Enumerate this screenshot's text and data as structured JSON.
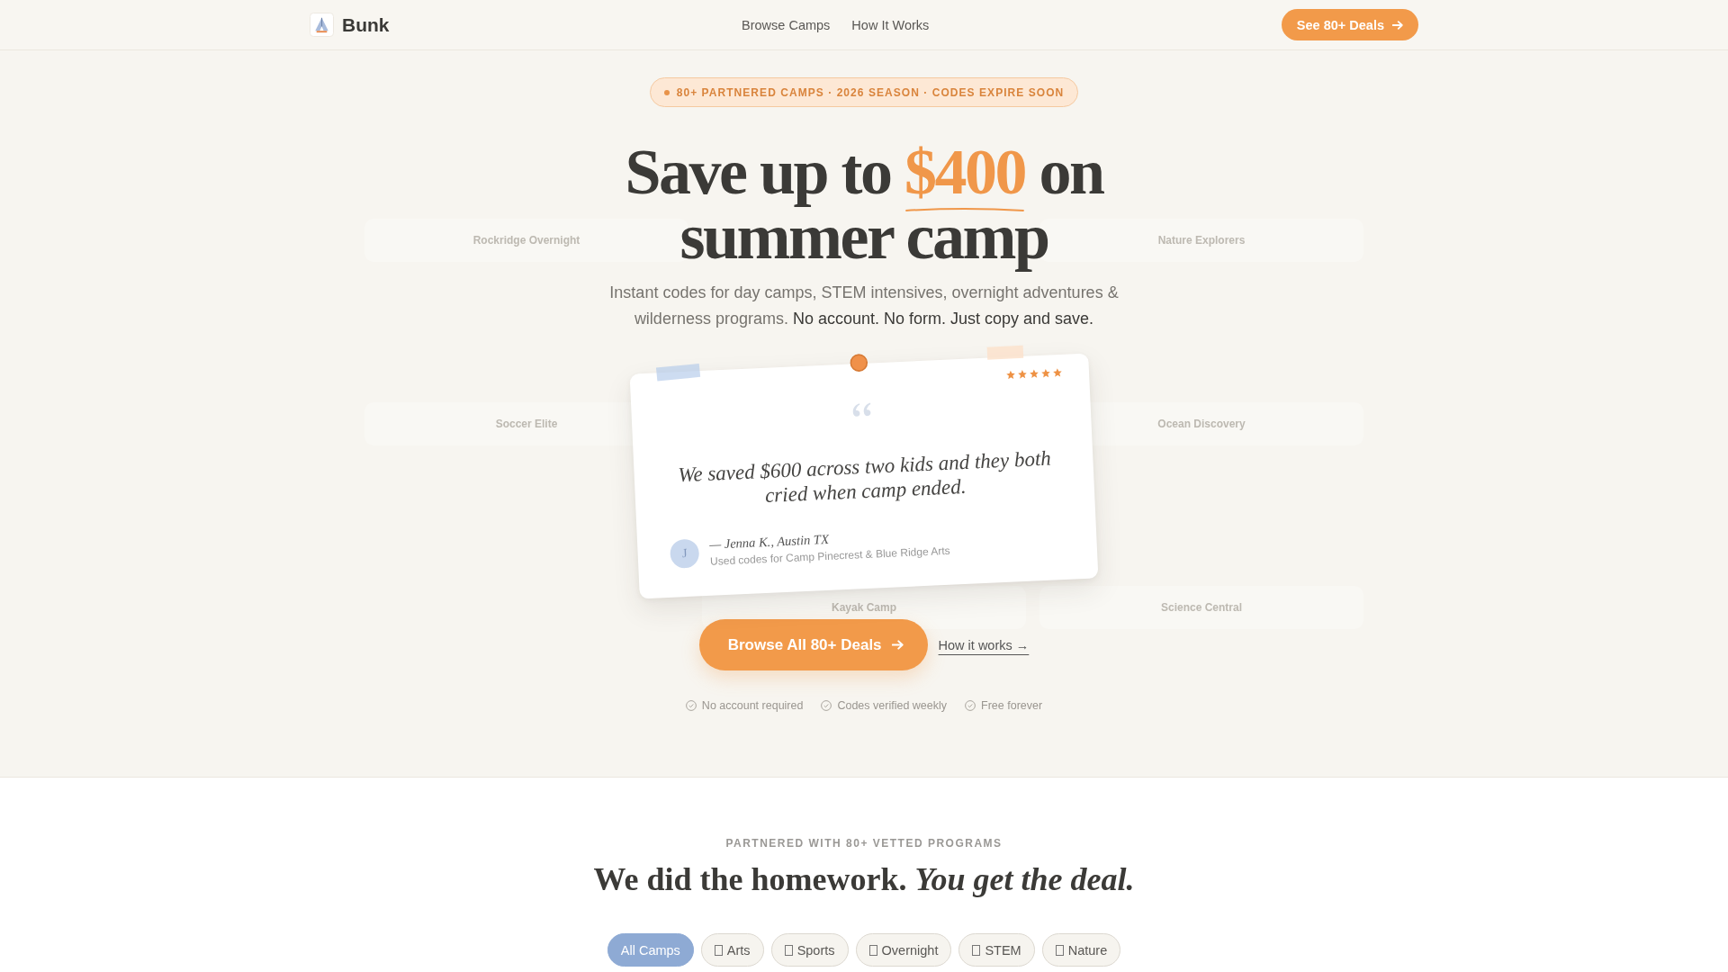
{
  "header": {
    "brand": "Bunk",
    "nav": [
      {
        "label": "Browse Camps"
      },
      {
        "label": "How It Works"
      }
    ],
    "cta": "See 80+ Deals"
  },
  "hero": {
    "background_cards": [
      {
        "name": "Rockridge Overnight"
      },
      {
        "name": "Nature Explorers"
      },
      {
        "name": "Soccer Elite"
      },
      {
        "name": "Ocean Discovery"
      },
      {
        "name": "Kayak Camp"
      },
      {
        "name": "Science Central"
      }
    ],
    "badge": "80+ PARTNERED CAMPS · 2026 SEASON · CODES EXPIRE SOON",
    "headline": {
      "before": "Save up to",
      "highlight": "$400",
      "after": "on summer camp"
    },
    "subtitle": {
      "text": "Instant codes for day camps, STEM intensives, overnight adventures & wilderness programs.",
      "emphasis": "No account. No form. Just copy and save."
    },
    "testimonial": {
      "stars": 5,
      "quote": "We saved $600 across two kids and they both cried when camp ended.",
      "avatar_initial": "J",
      "author": "— Jenna K., Austin TX",
      "detail": "Used codes for Camp Pinecrest & Blue Ridge Arts"
    },
    "primary_button": "Browse All 80+ Deals",
    "secondary_link": "How it works →",
    "trust_points": [
      "No account required",
      "Codes verified weekly",
      "Free forever"
    ]
  },
  "partners": {
    "eyebrow": "PARTNERED WITH 80+ VETTED PROGRAMS",
    "title": "We did the homework. *You get the deal.*",
    "filters": [
      {
        "label": "All Camps",
        "kind": "all",
        "selected": true
      },
      {
        "label": "Arts",
        "kind": "category",
        "selected": false
      },
      {
        "label": "Sports",
        "kind": "category",
        "selected": false
      },
      {
        "label": "Overnight",
        "kind": "category",
        "selected": false
      },
      {
        "label": "STEM",
        "kind": "category",
        "selected": false
      },
      {
        "label": "Nature",
        "kind": "category",
        "selected": false
      }
    ]
  }
}
